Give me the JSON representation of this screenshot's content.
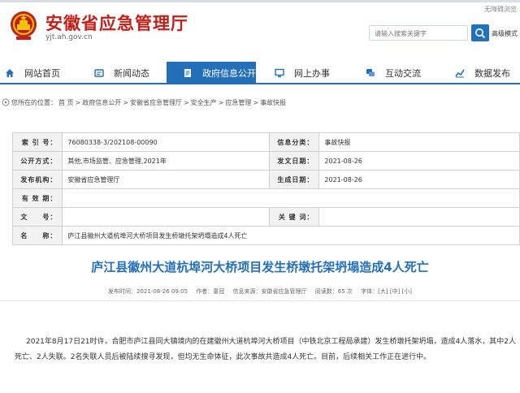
{
  "header": {
    "title": "安徽省应急管理厅",
    "domain": "yjt.ah.gov.cn",
    "top_links": [
      "无障碍浏览"
    ],
    "search_placeholder": "请输入搜索关键字",
    "elderly_mode": "高级模式"
  },
  "nav": {
    "items": [
      {
        "label": "网站首页",
        "icon": "home-icon"
      },
      {
        "label": "新闻动态",
        "icon": "news-icon"
      },
      {
        "label": "政府信息公开",
        "icon": "document-icon",
        "active": true
      },
      {
        "label": "网上办事",
        "icon": "monitor-icon"
      },
      {
        "label": "互动交流",
        "icon": "chat-icon"
      },
      {
        "label": "数据发布",
        "icon": "chart-icon"
      }
    ]
  },
  "breadcrumb": {
    "prefix": "您所在的位置：",
    "items": [
      "首 页",
      "政府信息公开",
      "安徽省应急管理厅",
      "安全生产",
      "应急管理",
      "事故快报"
    ],
    "separator": ">"
  },
  "meta": {
    "rows": [
      {
        "k1": "索 引 号：",
        "v1": "76080338-3/202108-00090",
        "k2": "信息分类：",
        "v2": "事故快报"
      },
      {
        "k1": "公开方式：",
        "v1": "其他,市场监管、应急管理,2021年",
        "k2": "发文日期：",
        "v2": "2021-08-26"
      },
      {
        "k1": "发布机构：",
        "v1": "安徽省应急管理厅",
        "k2": "生成日期：",
        "v2": "2021-08-26"
      },
      {
        "k1": "有 效 期：",
        "v1": ""
      },
      {
        "k1": "文　　号：",
        "v1": "",
        "k2": "关 键 词：",
        "v2": ""
      },
      {
        "k1": "名　　称：",
        "v1": "庐江县徽州大道杭埠河大桥项目发生桥墩托架坍塌造成4人死亡"
      }
    ]
  },
  "article": {
    "title": "庐江县徽州大道杭埠河大桥项目发生桥墩托架坍塌造成4人死亡",
    "meta": [
      "发布时间：2021-08-26 09:05",
      "作者：童冠",
      "信息来源：安徽省应急管理厅",
      "阅读数：65 次",
      "字体：[大] [中] [小]"
    ],
    "body": "2021年8月17日21时许，合肥市庐江县同大镇境内的在建徽州大道杭埠河大桥项目（中铁北京工程局承建）发生桥墩托架坍塌，造成4人落水，其中2人死亡、2人失联。2名失联人员后被陆续搜寻发现，但均无生命体征，此次事故共造成4人死亡。目前，后续相关工作正在进行中。"
  },
  "colors": {
    "brand_red": "#c1201a",
    "nav_blue": "#2470b8",
    "title_blue": "#2470b8"
  }
}
